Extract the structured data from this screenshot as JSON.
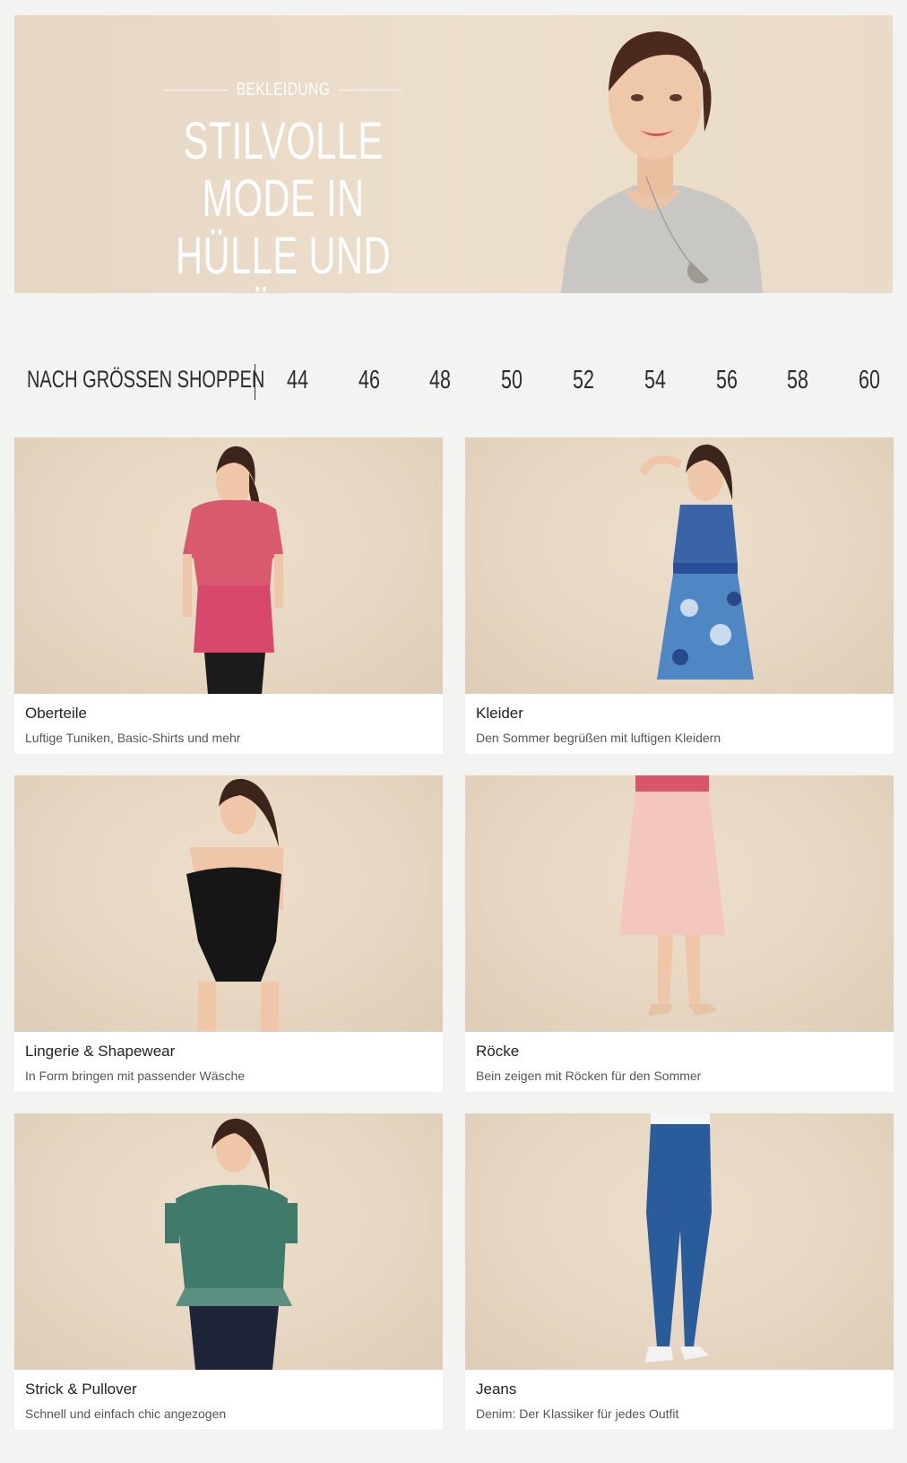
{
  "hero": {
    "kicker": "BEKLEIDUNG",
    "title_line1": "STILVOLLE MODE IN",
    "title_line2": "HÜLLE UND FÜLLE"
  },
  "sizes": {
    "label": "NACH GRÖSSEN SHOPPEN",
    "items": [
      "44",
      "46",
      "48",
      "50",
      "52",
      "54",
      "56",
      "58",
      "60"
    ]
  },
  "categories": [
    {
      "title": "Oberteile",
      "subtitle": "Luftige Tuniken, Basic-Shirts und mehr"
    },
    {
      "title": "Kleider",
      "subtitle": "Den Sommer begrüßen mit luftigen Kleidern"
    },
    {
      "title": "Lingerie & Shapewear",
      "subtitle": "In Form bringen mit passender Wäsche"
    },
    {
      "title": "Röcke",
      "subtitle": "Bein zeigen mit Röcken für den Sommer"
    },
    {
      "title": "Strick & Pullover",
      "subtitle": "Schnell und einfach chic angezogen"
    },
    {
      "title": "Jeans",
      "subtitle": "Denim: Der Klassiker für jedes Outfit"
    }
  ],
  "colors": {
    "backdrop": "#e8d9c5",
    "page": "#f3f3f2",
    "text": "#2b2b2b"
  }
}
